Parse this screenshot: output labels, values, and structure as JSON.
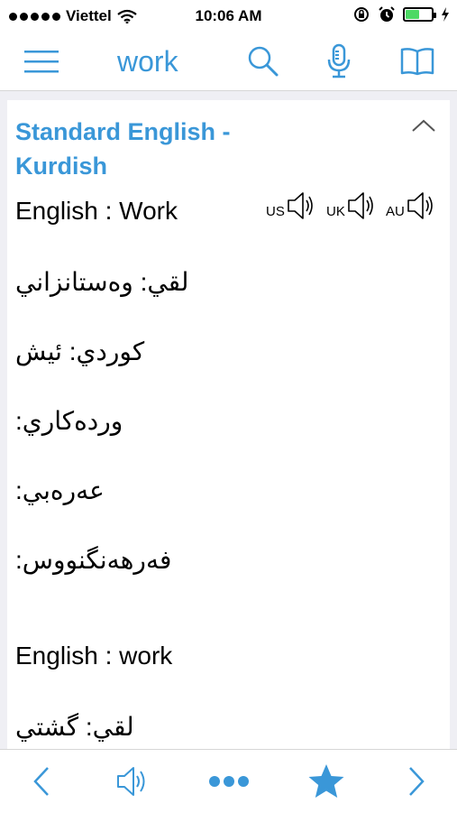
{
  "status_bar": {
    "carrier": "Viettel",
    "time": "10:06 AM"
  },
  "toolbar": {
    "query": "work",
    "icons": [
      "menu-icon",
      "search-icon",
      "microphone-icon",
      "book-icon"
    ]
  },
  "section": {
    "title": "Standard English - Kurdish",
    "entries": [
      {
        "label": "English : Work"
      },
      {
        "label": "لقي: وەستانزاني"
      },
      {
        "label": "كوردي: ئيش"
      },
      {
        "label": "وردەكاري:"
      },
      {
        "label": "عەرەبي:"
      },
      {
        "label": "فەرهەنگنووس:"
      },
      {
        "label": "English : work"
      },
      {
        "label": "لقي: گشتي"
      }
    ],
    "audio": [
      "US",
      "UK",
      "AU"
    ]
  },
  "bottom_bar": {
    "icons": [
      "back-icon",
      "speaker-icon",
      "more-icon",
      "star-icon",
      "forward-icon"
    ]
  },
  "colors": {
    "accent": "#3a97d8",
    "battery": "#4cd964"
  },
  "battery_level": 0.55
}
